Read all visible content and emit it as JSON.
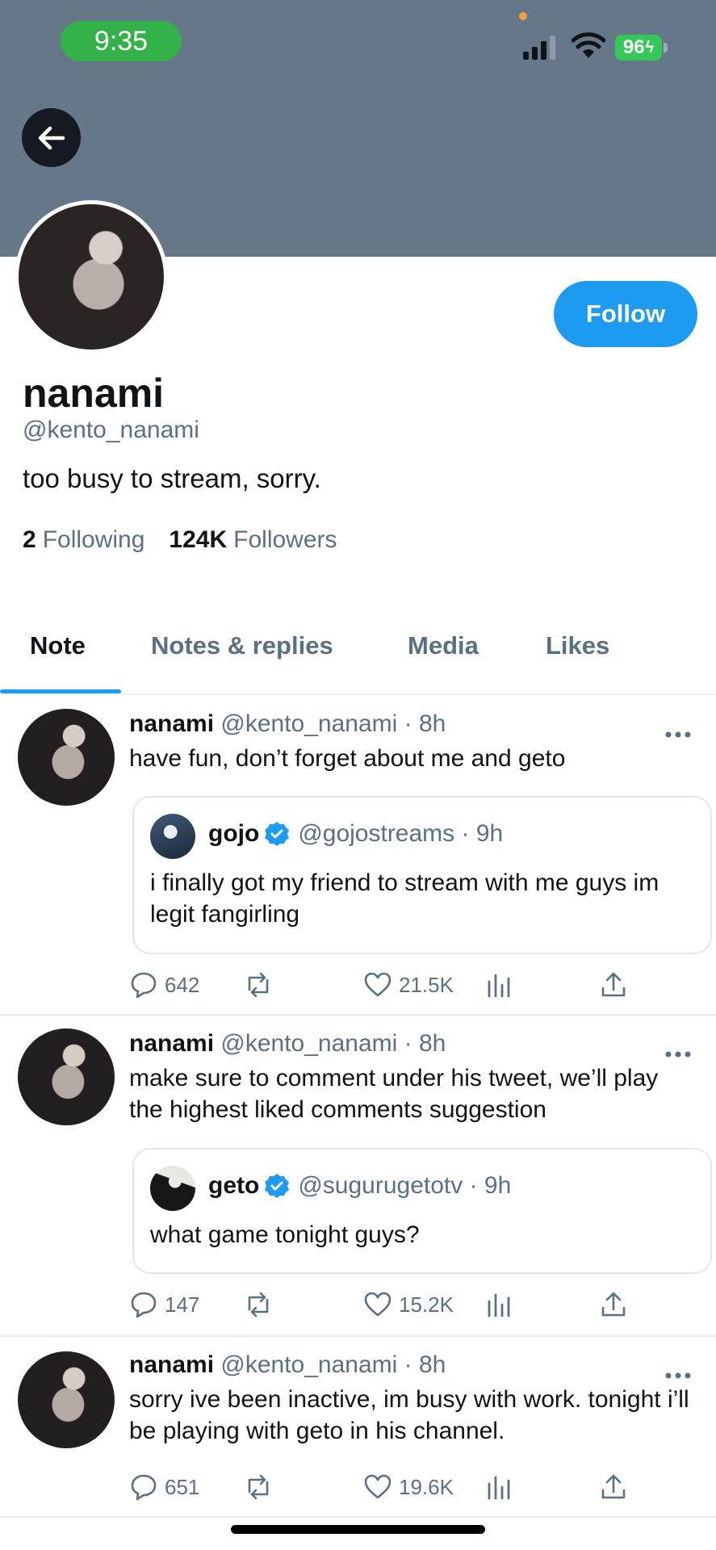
{
  "status_bar": {
    "time": "9:35",
    "battery": "96"
  },
  "profile": {
    "name": "nanami",
    "handle": "@kento_nanami",
    "bio": "too busy to stream, sorry.",
    "following_count": "2",
    "following_label": "Following",
    "followers_count": "124K",
    "followers_label": "Followers",
    "follow_label": "Follow"
  },
  "tabs": [
    {
      "label": "Note",
      "active": true
    },
    {
      "label": "Notes & replies",
      "active": false
    },
    {
      "label": "Media",
      "active": false
    },
    {
      "label": "Likes",
      "active": false
    }
  ],
  "notes": [
    {
      "author": "nanami",
      "handle": "@kento_nanami",
      "time": "8h",
      "text": "have fun, don’t forget about me and geto",
      "quote": {
        "name": "gojo",
        "handle": "@gojostreams",
        "time": "9h",
        "text": "i finally got my friend to stream with me guys im legit fangirling"
      },
      "replies": "642",
      "likes": "21.5K"
    },
    {
      "author": "nanami",
      "handle": "@kento_nanami",
      "time": "8h",
      "text": "make sure to comment under his tweet, we’ll play the highest liked comments suggestion",
      "quote": {
        "name": "geto",
        "handle": "@sugurugetotv",
        "time": "9h",
        "text": "what game tonight guys?"
      },
      "replies": "147",
      "likes": "15.2K"
    },
    {
      "author": "nanami",
      "handle": "@kento_nanami",
      "time": "8h",
      "text": "sorry ive been inactive, im busy with work. tonight i’ll be playing with geto in his channel.",
      "replies": "651",
      "likes": "19.6K"
    }
  ],
  "colors": {
    "accent": "#1d9bf0",
    "banner": "#66778a",
    "muted": "#5b7083"
  }
}
